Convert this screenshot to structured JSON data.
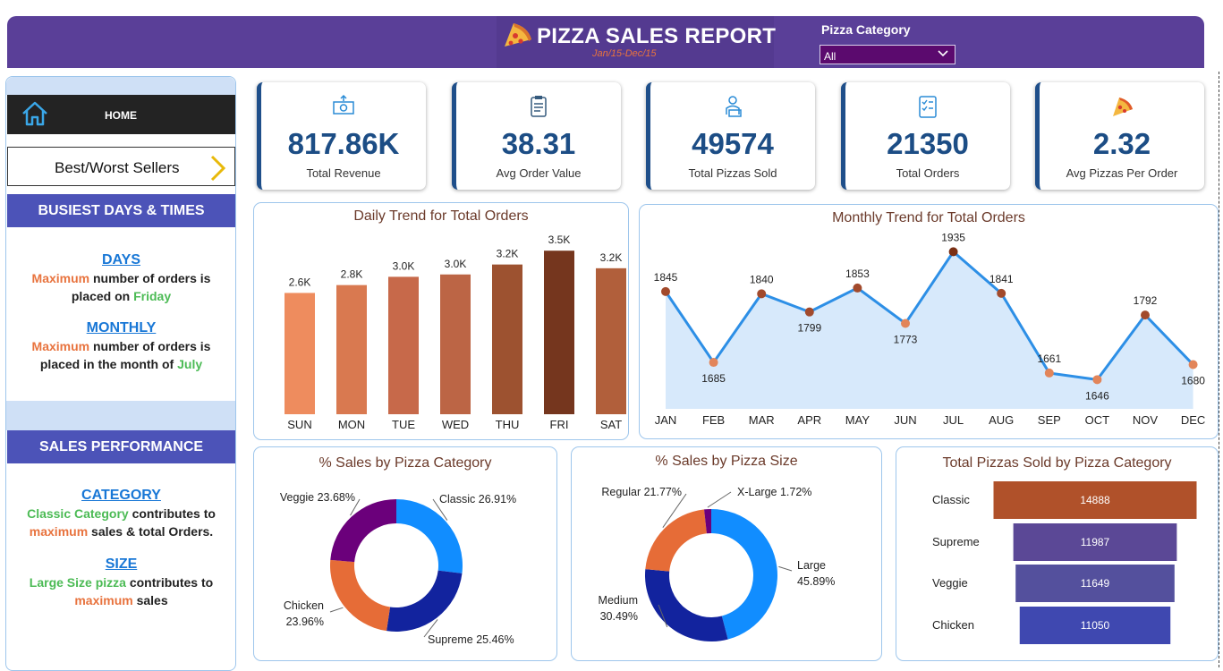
{
  "header": {
    "title": "PIZZA SALES REPORT",
    "subtitle": "Jan/15-Dec/15",
    "filter_label": "Pizza Category",
    "filter_value": "All"
  },
  "nav": {
    "home_label": "HOME",
    "best_worst_label": "Best/Worst Sellers"
  },
  "busiest": {
    "heading": "BUSIEST DAYS & TIMES",
    "days_link": "DAYS",
    "days_line1_a": "Maximum",
    "days_line1_b": " number of orders is",
    "days_line2_a": "placed on ",
    "days_line2_b": "Friday",
    "monthly_link": "MONTHLY",
    "monthly_line1_a": "Maximum",
    "monthly_line1_b": " number of orders is",
    "monthly_line2_a": "placed in the month of ",
    "monthly_line2_b": "July"
  },
  "performance": {
    "heading": "SALES PERFORMANCE",
    "category_link": "CATEGORY",
    "cat_line1_a": "Classic Category",
    "cat_line1_b": " contributes to",
    "cat_line2_a": "maximum",
    "cat_line2_b": " sales & total Orders.",
    "size_link": "SIZE",
    "size_line1_a": "Large Size pizza",
    "size_line1_b": " contributes to",
    "size_line2_a": "maximum",
    "size_line2_b": " sales"
  },
  "kpis": [
    {
      "value": "817.86K",
      "label": "Total Revenue",
      "icon": "money-icon"
    },
    {
      "value": "38.31",
      "label": "Avg Order Value",
      "icon": "clipboard-icon"
    },
    {
      "value": "49574",
      "label": "Total Pizzas Sold",
      "icon": "delivery-icon"
    },
    {
      "value": "21350",
      "label": "Total Orders",
      "icon": "checklist-icon"
    },
    {
      "value": "2.32",
      "label": "Avg Pizzas Per Order",
      "icon": "pizza-slice-icon"
    }
  ],
  "colors": {
    "header": "#5a3f98",
    "kpi_value": "#1c4d85",
    "accent_orange": "#e8733e",
    "accent_green": "#4cbb55",
    "section_blue": "#4c53b8"
  },
  "chart_data": [
    {
      "type": "bar",
      "title": "Daily Trend for Total Orders",
      "categories": [
        "SUN",
        "MON",
        "TUE",
        "WED",
        "THU",
        "FRI",
        "SAT"
      ],
      "values": [
        2624,
        2794,
        2973,
        3024,
        3239,
        3538,
        3158
      ],
      "data_labels": [
        "2.6K",
        "2.8K",
        "3.0K",
        "3.0K",
        "3.2K",
        "3.5K",
        "3.2K"
      ],
      "colors": [
        "#ee8c5e",
        "#d97950",
        "#c7694a",
        "#bc6545",
        "#9d5230",
        "#75361e",
        "#b15f3b"
      ],
      "ylim": [
        0,
        3600
      ]
    },
    {
      "type": "area",
      "title": "Monthly Trend for Total Orders",
      "categories": [
        "JAN",
        "FEB",
        "MAR",
        "APR",
        "MAY",
        "JUN",
        "JUL",
        "AUG",
        "SEP",
        "OCT",
        "NOV",
        "DEC"
      ],
      "values": [
        1845,
        1685,
        1840,
        1799,
        1853,
        1773,
        1935,
        1841,
        1661,
        1646,
        1792,
        1680
      ],
      "ylim": [
        1580,
        1960
      ]
    },
    {
      "type": "pie",
      "title": "% Sales by Pizza Category",
      "slices": [
        {
          "label": "Classic",
          "value": 26.91,
          "text": "Classic 26.91%",
          "color": "#118dff"
        },
        {
          "label": "Supreme",
          "value": 25.46,
          "text": "Supreme 25.46%",
          "color": "#12239e"
        },
        {
          "label": "Chicken",
          "value": 23.96,
          "text": "Chicken 23.96%",
          "color": "#e66c37"
        },
        {
          "label": "Veggie",
          "value": 23.68,
          "text": "Veggie 23.68%",
          "color": "#6b007b"
        }
      ]
    },
    {
      "type": "pie",
      "title": "% Sales by Pizza Size",
      "slices": [
        {
          "label": "Large",
          "value": 45.89,
          "text": "Large 45.89%",
          "color": "#118dff"
        },
        {
          "label": "Medium",
          "value": 30.49,
          "text": "Medium 30.49%",
          "color": "#12239e"
        },
        {
          "label": "Regular",
          "value": 21.77,
          "text": "Regular 21.77%",
          "color": "#e66c37"
        },
        {
          "label": "X-Large",
          "value": 1.72,
          "text": "X-Large 1.72%",
          "color": "#6b007b"
        }
      ]
    },
    {
      "type": "bar",
      "orientation": "horizontal-funnel",
      "title": "Total Pizzas Sold by Pizza Category",
      "categories": [
        "Classic",
        "Supreme",
        "Veggie",
        "Chicken"
      ],
      "values": [
        14888,
        11987,
        11649,
        11050
      ],
      "colors": [
        "#b0512a",
        "#5b4896",
        "#54509d",
        "#3f48b0"
      ]
    }
  ]
}
